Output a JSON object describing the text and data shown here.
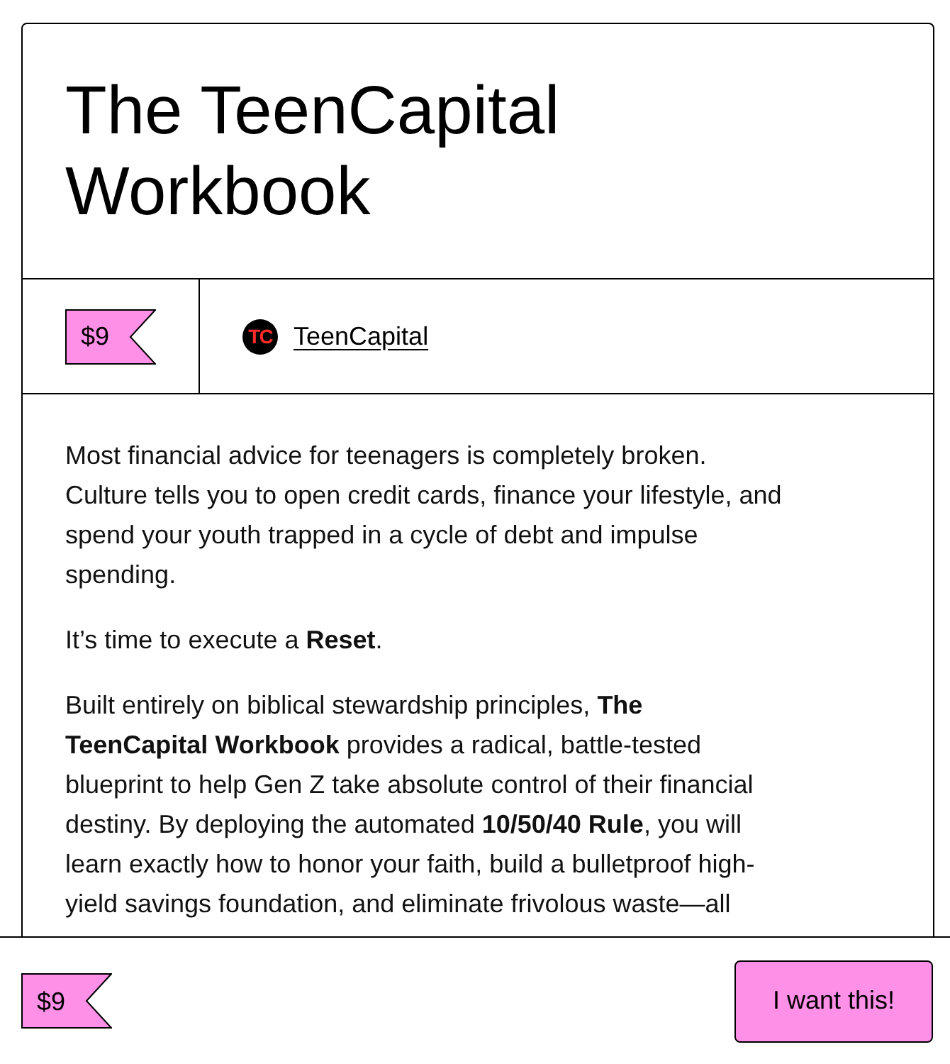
{
  "product": {
    "title": "The TeenCapital Workbook",
    "price": "$9",
    "creator": {
      "avatar_text": "TC",
      "name": "TeenCapital"
    },
    "description": [
      "Most financial advice for teenagers is completely broken. Culture tells you to open credit cards, finance your lifestyle, and spend your youth trapped in a cycle of debt and impulse spending.",
      "It’s time to execute a **Reset**.",
      "Built entirely on biblical stewardship principles, **The TeenCapital Workbook** provides a radical, battle-tested blueprint to help Gen Z take absolute control of their financial destiny. By deploying the automated **10/50/40 Rule**, you will learn exactly how to honor your faith, build a bulletproof high-yield savings foundation, and eliminate frivolous waste—all"
    ]
  },
  "purchase_bar": {
    "price": "$9",
    "button": "I want this!"
  }
}
